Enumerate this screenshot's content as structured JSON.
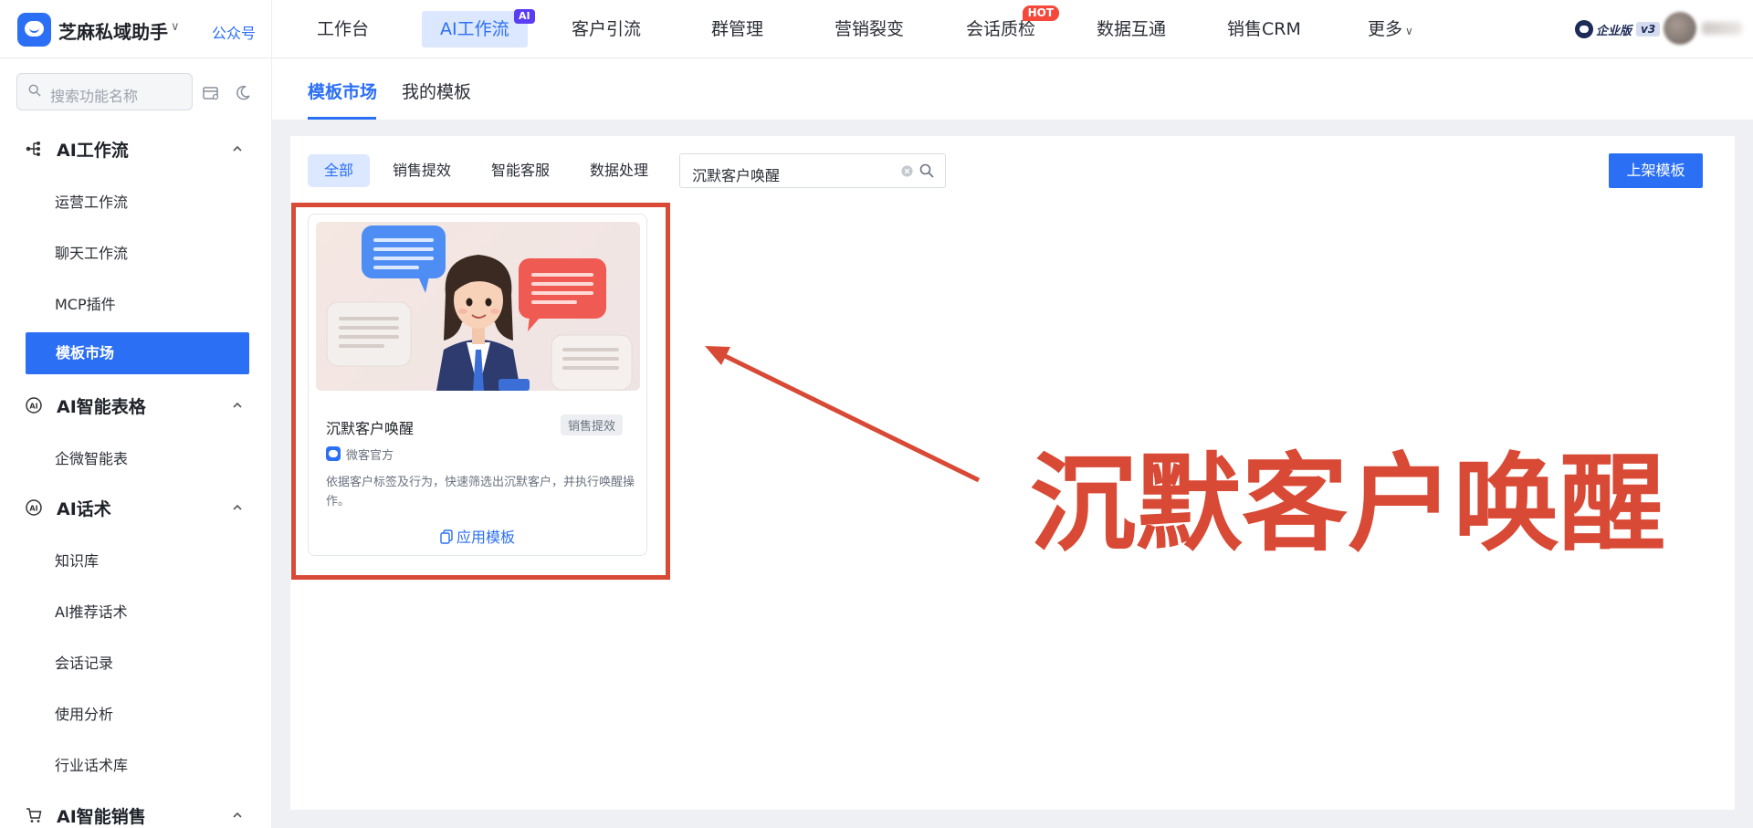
{
  "brand": {
    "name": "芝麻私域助手",
    "gzh_link": "公众号"
  },
  "topnav": {
    "items": [
      {
        "label": "工作台"
      },
      {
        "label": "AI工作流",
        "badge": "AI",
        "active": true
      },
      {
        "label": "客户引流"
      },
      {
        "label": "群管理"
      },
      {
        "label": "营销裂变"
      },
      {
        "label": "会话质检",
        "badge": "HOT"
      },
      {
        "label": "数据互通"
      },
      {
        "label": "销售CRM"
      },
      {
        "label": "更多"
      }
    ],
    "edition": {
      "label": "企业版",
      "version": "v3"
    }
  },
  "sidebar": {
    "search_placeholder": "搜索功能名称",
    "groups": [
      {
        "title": "AI工作流",
        "items": [
          "运营工作流",
          "聊天工作流",
          "MCP插件",
          "模板市场"
        ],
        "active_item": "模板市场"
      },
      {
        "title": "AI智能表格",
        "items": [
          "企微智能表"
        ]
      },
      {
        "title": "AI话术",
        "items": [
          "知识库",
          "AI推荐话术",
          "会话记录",
          "使用分析",
          "行业话术库"
        ]
      },
      {
        "title": "AI智能销售",
        "items": []
      }
    ]
  },
  "main": {
    "tabs": [
      {
        "label": "模板市场",
        "active": true
      },
      {
        "label": "我的模板"
      }
    ],
    "categories": [
      {
        "label": "全部",
        "active": true
      },
      {
        "label": "销售提效"
      },
      {
        "label": "智能客服"
      },
      {
        "label": "数据处理"
      }
    ],
    "search_value": "沉默客户唤醒",
    "publish_button": "上架模板",
    "cards": [
      {
        "title": "沉默客户唤醒",
        "tag": "销售提效",
        "author": "微客官方",
        "description": "依据客户标签及行为，快速筛选出沉默客户，并执行唤醒操作。",
        "apply_label": "应用模板"
      }
    ]
  },
  "annotation": {
    "text": "沉默客户唤醒",
    "color": "#d84a35"
  },
  "colors": {
    "accent": "#2b6ff5",
    "annotation": "#d84a35"
  }
}
